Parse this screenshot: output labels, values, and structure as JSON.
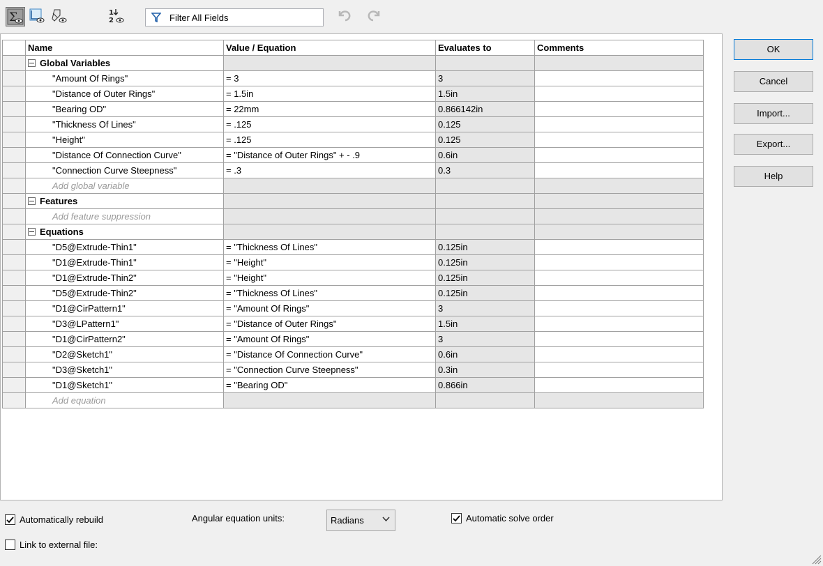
{
  "toolbar": {
    "buttons": [
      {
        "name": "equations-view-icon",
        "active": true
      },
      {
        "name": "sketch-equations-view-icon",
        "active": false
      },
      {
        "name": "dimensions-view-icon",
        "active": false
      },
      {
        "name": "ordered-view-icon",
        "active": false
      }
    ],
    "filter_placeholder": "Filter All Fields",
    "undo_icon": "undo-icon",
    "redo_icon": "redo-icon"
  },
  "columns": [
    "Name",
    "Value / Equation",
    "Evaluates to",
    "Comments"
  ],
  "sections": [
    {
      "title": "Global Variables",
      "rows": [
        {
          "name": "\"Amount Of Rings\"",
          "value": "= 3",
          "eval": "3"
        },
        {
          "name": "\"Distance of Outer Rings\"",
          "value": "= 1.5in",
          "eval": "1.5in"
        },
        {
          "name": "\"Bearing OD\"",
          "value": "= 22mm",
          "eval": "0.866142in"
        },
        {
          "name": "\"Thickness Of Lines\"",
          "value": "= .125",
          "eval": "0.125"
        },
        {
          "name": "\"Height\"",
          "value": "= .125",
          "eval": "0.125"
        },
        {
          "name": "\"Distance Of Connection Curve\"",
          "value": "= \"Distance of Outer Rings\" + - .9",
          "eval": "0.6in"
        },
        {
          "name": "\"Connection Curve Steepness\"",
          "value": "= .3",
          "eval": "0.3"
        }
      ],
      "add_hint": "Add global variable"
    },
    {
      "title": "Features",
      "rows": [],
      "add_hint": "Add feature suppression"
    },
    {
      "title": "Equations",
      "rows": [
        {
          "name": "\"D5@Extrude-Thin1\"",
          "value": "= \"Thickness Of Lines\"",
          "eval": "0.125in"
        },
        {
          "name": "\"D1@Extrude-Thin1\"",
          "value": "= \"Height\"",
          "eval": "0.125in"
        },
        {
          "name": "\"D1@Extrude-Thin2\"",
          "value": "= \"Height\"",
          "eval": "0.125in"
        },
        {
          "name": "\"D5@Extrude-Thin2\"",
          "value": "= \"Thickness Of Lines\"",
          "eval": "0.125in"
        },
        {
          "name": "\"D1@CirPattern1\"",
          "value": "= \"Amount Of Rings\"",
          "eval": "3"
        },
        {
          "name": "\"D3@LPattern1\"",
          "value": "= \"Distance of Outer Rings\"",
          "eval": "1.5in"
        },
        {
          "name": "\"D1@CirPattern2\"",
          "value": "= \"Amount Of Rings\"",
          "eval": "3"
        },
        {
          "name": "\"D2@Sketch1\"",
          "value": "= \"Distance Of Connection Curve\"",
          "eval": "0.6in"
        },
        {
          "name": "\"D3@Sketch1\"",
          "value": "= \"Connection Curve Steepness\"",
          "eval": "0.3in"
        },
        {
          "name": "\"D1@Sketch1\"",
          "value": "= \"Bearing OD\"",
          "eval": "0.866in"
        }
      ],
      "add_hint": "Add equation"
    }
  ],
  "buttons": {
    "ok": "OK",
    "cancel": "Cancel",
    "import": "Import...",
    "export": "Export...",
    "help": "Help"
  },
  "bottom": {
    "auto_rebuild": {
      "label": "Automatically rebuild",
      "checked": true
    },
    "link_external": {
      "label": "Link to external file:",
      "checked": false
    },
    "angular_units_label": "Angular equation units:",
    "angular_units_value": "Radians",
    "auto_solve": {
      "label": "Automatic solve order",
      "checked": true
    }
  },
  "colors": {
    "grid_border": "#a0a0a0",
    "evaluated_bg": "#e6e6e6",
    "hint_text": "#9a9a9a",
    "default_button_border": "#0078d7"
  }
}
